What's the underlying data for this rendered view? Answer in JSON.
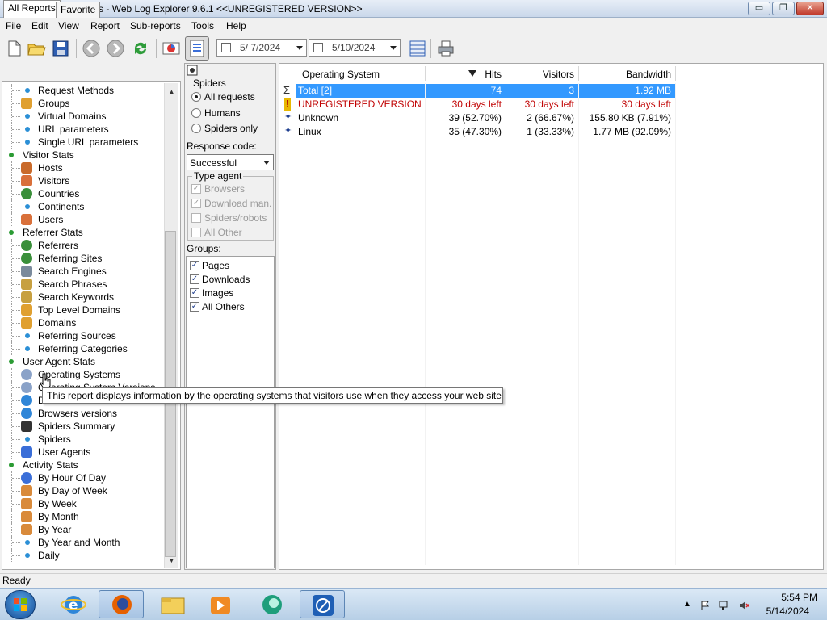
{
  "window": {
    "title": "Operating Systems - Web Log Explorer 9.6.1 <<UNREGISTERED VERSION>>",
    "controls": {
      "minimize": "▭",
      "maximize": "❐",
      "close": "✕"
    }
  },
  "menu": [
    "File",
    "Edit",
    "View",
    "Report",
    "Sub-reports",
    "Tools",
    "Help"
  ],
  "toolbar": {
    "icons": [
      "new-icon",
      "open-folder-icon",
      "save-icon",
      "back-icon",
      "forward-icon",
      "refresh-icon",
      "chart-icon",
      "filter-icon",
      "columns-icon",
      "print-icon"
    ],
    "date_from": "5/ 7/2024",
    "date_to": "5/10/2024"
  },
  "left_panel": {
    "tabs": [
      "All Reports",
      "Favorite"
    ],
    "tree": [
      {
        "label": "Request Methods",
        "type": "leaf",
        "icon": "dot"
      },
      {
        "label": "Groups",
        "type": "leaf",
        "icon": "grid-icon"
      },
      {
        "label": "Virtual Domains",
        "type": "leaf",
        "icon": "dot"
      },
      {
        "label": "URL parameters",
        "type": "leaf",
        "icon": "dot"
      },
      {
        "label": "Single URL parameters",
        "type": "leaf",
        "icon": "dot"
      },
      {
        "label": "Visitor Stats",
        "type": "group"
      },
      {
        "label": "Hosts",
        "type": "leaf",
        "icon": "host-icon"
      },
      {
        "label": "Visitors",
        "type": "leaf",
        "icon": "person-icon"
      },
      {
        "label": "Countries",
        "type": "leaf",
        "icon": "globe-icon"
      },
      {
        "label": "Continents",
        "type": "leaf",
        "icon": "dot"
      },
      {
        "label": "Users",
        "type": "leaf",
        "icon": "person-icon"
      },
      {
        "label": "Referrer Stats",
        "type": "group"
      },
      {
        "label": "Referrers",
        "type": "leaf",
        "icon": "globe-icon"
      },
      {
        "label": "Referring Sites",
        "type": "leaf",
        "icon": "globe-icon"
      },
      {
        "label": "Search Engines",
        "type": "leaf",
        "icon": "server-icon"
      },
      {
        "label": "Search Phrases",
        "type": "leaf",
        "icon": "magnifier-icon"
      },
      {
        "label": "Search Keywords",
        "type": "leaf",
        "icon": "magnifier-icon"
      },
      {
        "label": "Top Level Domains",
        "type": "leaf",
        "icon": "grid-icon"
      },
      {
        "label": "Domains",
        "type": "leaf",
        "icon": "grid-icon"
      },
      {
        "label": "Referring Sources",
        "type": "leaf",
        "icon": "dot"
      },
      {
        "label": "Referring Categories",
        "type": "leaf",
        "icon": "dot"
      },
      {
        "label": "User Agent Stats",
        "type": "group"
      },
      {
        "label": "Operating Systems",
        "type": "leaf",
        "icon": "disc-icon"
      },
      {
        "label": "Operating System Versions",
        "type": "leaf",
        "icon": "disc-icon"
      },
      {
        "label": "Browsers",
        "type": "leaf",
        "icon": "ie-icon"
      },
      {
        "label": "Browsers versions",
        "type": "leaf",
        "icon": "ie-icon"
      },
      {
        "label": "Spiders Summary",
        "type": "leaf",
        "icon": "spider-icon"
      },
      {
        "label": "Spiders",
        "type": "leaf",
        "icon": "dot"
      },
      {
        "label": "User Agents",
        "type": "leaf",
        "icon": "window-icon"
      },
      {
        "label": "Activity Stats",
        "type": "group"
      },
      {
        "label": "By Hour Of Day",
        "type": "leaf",
        "icon": "clock-icon"
      },
      {
        "label": "By Day of Week",
        "type": "leaf",
        "icon": "calendar-icon"
      },
      {
        "label": "By Week",
        "type": "leaf",
        "icon": "calendar-icon"
      },
      {
        "label": "By Month",
        "type": "leaf",
        "icon": "calendar-icon"
      },
      {
        "label": "By Year",
        "type": "leaf",
        "icon": "calendar-icon"
      },
      {
        "label": "By Year and Month",
        "type": "leaf",
        "icon": "dot"
      },
      {
        "label": "Daily",
        "type": "leaf",
        "icon": "dot"
      }
    ]
  },
  "filters": {
    "spiders_label": "Spiders",
    "spider_options": [
      {
        "label": "All requests",
        "selected": true
      },
      {
        "label": "Humans",
        "selected": false
      },
      {
        "label": "Spiders only",
        "selected": false
      }
    ],
    "response_code_label": "Response code:",
    "response_code_value": "Successful",
    "type_agent_label": "Type agent",
    "type_agent": [
      {
        "label": "Browsers",
        "checked": true
      },
      {
        "label": "Download man.",
        "checked": true
      },
      {
        "label": "Spiders/robots",
        "checked": false
      },
      {
        "label": "All Other",
        "checked": false
      }
    ],
    "groups_label": "Groups:",
    "groups": [
      {
        "label": "Pages",
        "checked": true
      },
      {
        "label": "Downloads",
        "checked": true
      },
      {
        "label": "Images",
        "checked": true
      },
      {
        "label": "All Others",
        "checked": true
      }
    ]
  },
  "report": {
    "columns": [
      "Operating System",
      "Hits",
      "Visitors",
      "Bandwidth"
    ],
    "rows": [
      {
        "name": "Total [2]",
        "hits": "74",
        "visitors": "3",
        "bandwidth": "1.92 MB",
        "style": "total"
      },
      {
        "name": "UNREGISTERED VERSION",
        "hits": "30 days left",
        "visitors": "30 days left",
        "bandwidth": "30 days left",
        "style": "warning"
      },
      {
        "name": "Unknown",
        "hits": "39 (52.70%)",
        "visitors": "2 (66.67%)",
        "bandwidth": "155.80 KB (7.91%)",
        "style": "normal"
      },
      {
        "name": "Linux",
        "hits": "35 (47.30%)",
        "visitors": "1 (33.33%)",
        "bandwidth": "1.77 MB (92.09%)",
        "style": "normal"
      }
    ]
  },
  "tooltip": "This report displays information by the operating systems that visitors use when they access your web site.",
  "status": "Ready",
  "taskbar": {
    "apps": [
      "internet-explorer-icon",
      "firefox-icon",
      "file-explorer-icon",
      "media-player-icon",
      "messenger-icon",
      "web-log-explorer-icon"
    ],
    "time": "5:54 PM",
    "date": "5/14/2024"
  },
  "colors": {
    "selection": "#3399ff",
    "warning": "#c00000",
    "group_bullet": "#2b9b34",
    "leaf_bullet": "#2b8fd6"
  }
}
